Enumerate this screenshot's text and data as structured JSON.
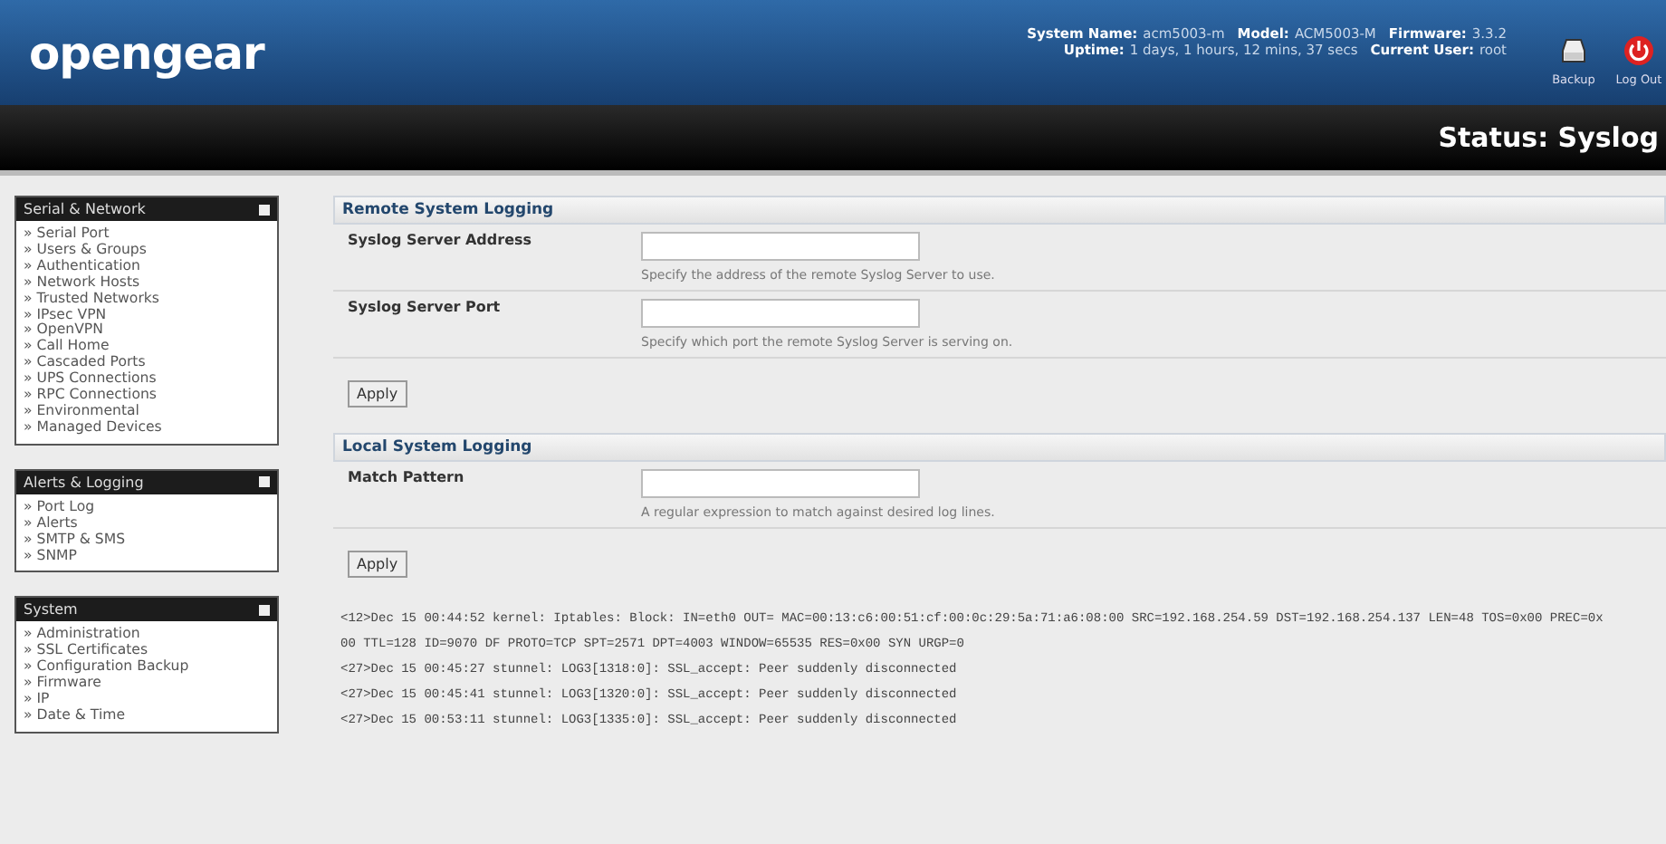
{
  "header": {
    "logo": "opengear",
    "info": [
      [
        {
          "label": "System Name:",
          "value": "acm5003-m"
        },
        {
          "label": "Model:",
          "value": "ACM5003-M"
        },
        {
          "label": "Firmware:",
          "value": "3.3.2"
        }
      ],
      [
        {
          "label": "Uptime:",
          "value": "1 days, 1 hours, 12 mins, 37 secs"
        },
        {
          "label": "Current User:",
          "value": "root"
        }
      ]
    ],
    "actions": [
      {
        "kind": "backup",
        "label": "Backup"
      },
      {
        "kind": "logout",
        "label": "Log Out"
      }
    ]
  },
  "page_title": "Status: Syslog",
  "sidebar": [
    {
      "title": "Serial & Network",
      "items": [
        "» Serial Port",
        "» Users & Groups",
        "» Authentication",
        "» Network Hosts",
        "» Trusted Networks",
        "» IPsec VPN",
        "» OpenVPN",
        "» Call Home",
        "» Cascaded Ports",
        "» UPS Connections",
        "» RPC Connections",
        "» Environmental",
        "» Managed Devices"
      ]
    },
    {
      "title": "Alerts & Logging",
      "items": [
        "» Port Log",
        "» Alerts",
        "» SMTP & SMS",
        "» SNMP"
      ]
    },
    {
      "title": "System",
      "items": [
        "» Administration",
        "» SSL Certificates",
        "» Configuration Backup",
        "» Firmware",
        "» IP",
        "» Date & Time"
      ]
    }
  ],
  "sections": [
    {
      "title": "Remote System Logging",
      "fields": [
        {
          "label": "Syslog Server Address",
          "hint": "Specify the address of the remote Syslog Server to use."
        },
        {
          "label": "Syslog Server Port",
          "hint": "Specify which port the remote Syslog Server is serving on."
        }
      ],
      "button": "Apply"
    },
    {
      "title": "Local System Logging",
      "fields": [
        {
          "label": "Match Pattern",
          "hint": "A regular expression to match against desired log lines."
        }
      ],
      "button": "Apply"
    }
  ],
  "log": [
    "<12>Dec 15 00:44:52 kernel: Iptables: Block: IN=eth0 OUT= MAC=00:13:c6:00:51:cf:00:0c:29:5a:71:a6:08:00 SRC=192.168.254.59 DST=192.168.254.137 LEN=48 TOS=0x00 PREC=0x00 TTL=128 ID=9070 DF PROTO=TCP SPT=2571 DPT=4003 WINDOW=65535 RES=0x00 SYN URGP=0",
    "<27>Dec 15 00:45:27 stunnel: LOG3[1318:0]: SSL_accept: Peer suddenly disconnected",
    "<27>Dec 15 00:45:41 stunnel: LOG3[1320:0]: SSL_accept: Peer suddenly disconnected",
    "<27>Dec 15 00:53:11 stunnel: LOG3[1335:0]: SSL_accept: Peer suddenly disconnected"
  ]
}
